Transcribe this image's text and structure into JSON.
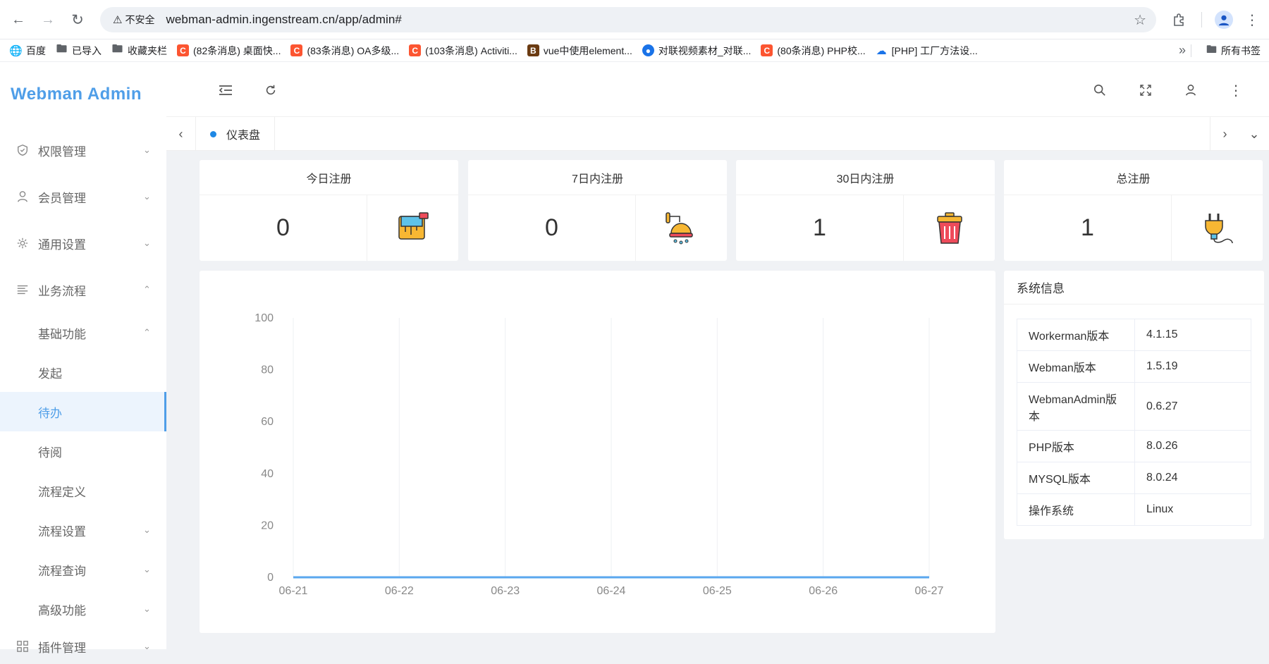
{
  "browser": {
    "security_label": "不安全",
    "url": "webman-admin.ingenstream.cn/app/admin#",
    "bookmarks": [
      {
        "label": "百度",
        "icon": "globe-icon"
      },
      {
        "label": "已导入",
        "icon": "folder-icon"
      },
      {
        "label": "收藏夹栏",
        "icon": "folder-icon"
      },
      {
        "label": "(82条消息) 桌面快...",
        "icon": "csdn-icon"
      },
      {
        "label": "(83条消息) OA多级...",
        "icon": "csdn-icon"
      },
      {
        "label": "(103条消息) Activiti...",
        "icon": "csdn-icon"
      },
      {
        "label": "vue中使用element...",
        "icon": "bb-icon"
      },
      {
        "label": "对联视频素材_对联...",
        "icon": "blue-globe-icon"
      },
      {
        "label": "(80条消息) PHP校...",
        "icon": "csdn-icon"
      },
      {
        "label": "[PHP] 工厂方法设...",
        "icon": "cloud-icon"
      }
    ],
    "all_bookmarks_label": "所有书签"
  },
  "sidebar": {
    "logo": "Webman Admin",
    "menu": [
      {
        "label": "权限管理",
        "icon": "shield-icon",
        "expanded": false
      },
      {
        "label": "会员管理",
        "icon": "user-icon",
        "expanded": false
      },
      {
        "label": "通用设置",
        "icon": "gear-icon",
        "expanded": false
      },
      {
        "label": "业务流程",
        "icon": "list-icon",
        "expanded": true
      }
    ],
    "sub": {
      "basic": "基础功能",
      "items": [
        "发起",
        "待办",
        "待阅",
        "流程定义"
      ],
      "active": "待办",
      "more": [
        "流程设置",
        "流程查询",
        "高级功能"
      ]
    },
    "plugin": "插件管理"
  },
  "tabs": [
    {
      "label": "仪表盘",
      "active": true
    }
  ],
  "stats": [
    {
      "title": "今日注册",
      "value": "0",
      "icon": "paint-bucket-icon"
    },
    {
      "title": "7日内注册",
      "value": "0",
      "icon": "shower-icon"
    },
    {
      "title": "30日内注册",
      "value": "1",
      "icon": "trash-can-icon"
    },
    {
      "title": "总注册",
      "value": "1",
      "icon": "plug-icon"
    }
  ],
  "chart_data": {
    "type": "line",
    "x": [
      "06-21",
      "06-22",
      "06-23",
      "06-24",
      "06-25",
      "06-26",
      "06-27"
    ],
    "series": [
      {
        "values": [
          0,
          0,
          0,
          0,
          0,
          0,
          0
        ]
      }
    ],
    "ylim": [
      0,
      100
    ],
    "yticks": [
      0,
      20,
      40,
      60,
      80,
      100
    ],
    "color": "#5aa7ee",
    "grid": "vertical"
  },
  "system_info": {
    "title": "系统信息",
    "rows": [
      {
        "key": "Workerman版本",
        "value": "4.1.15"
      },
      {
        "key": "Webman版本",
        "value": "1.5.19"
      },
      {
        "key": "WebmanAdmin版本",
        "value": "0.6.27"
      },
      {
        "key": "PHP版本",
        "value": "8.0.26"
      },
      {
        "key": "MYSQL版本",
        "value": "8.0.24"
      },
      {
        "key": "操作系统",
        "value": "Linux"
      }
    ]
  }
}
